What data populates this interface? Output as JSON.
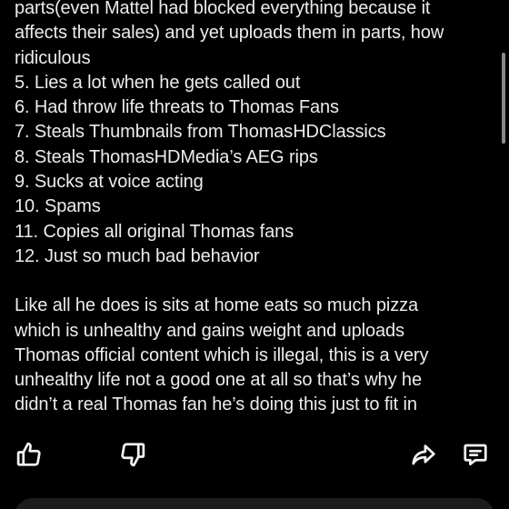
{
  "post": {
    "lines": [
      "parts(even Mattel had blocked everything because it",
      "affects their sales) and yet uploads them in parts, how",
      "ridiculous",
      "5. Lies a lot when he gets called out",
      "6. Had throw life threats to Thomas Fans",
      "7. Steals Thumbnails from ThomasHDClassics",
      "8. Steals ThomasHDMedia’s AEG rips",
      "9. Sucks at voice acting",
      "10. Spams",
      "11. Copies all original Thomas fans",
      "12. Just so much bad behavior"
    ],
    "closing_lines": [
      "Like all he does is sits at home eats so much pizza",
      "which is unhealthy and gains weight and uploads",
      "Thomas official content which is illegal, this is a very",
      "unhealthy life not a good one at all so that’s why he",
      "didn’t a real Thomas fan he’s doing this just to fit in"
    ]
  },
  "actions": {
    "upvote_icon": "thumbs-up-icon",
    "downvote_icon": "thumbs-down-icon",
    "share_icon": "share-arrow-icon",
    "comment_icon": "comment-bubble-icon"
  },
  "colors": {
    "background": "#000000",
    "text": "#ececec",
    "icon": "#f2f2f2",
    "input_bar": "#1c1c1c"
  }
}
